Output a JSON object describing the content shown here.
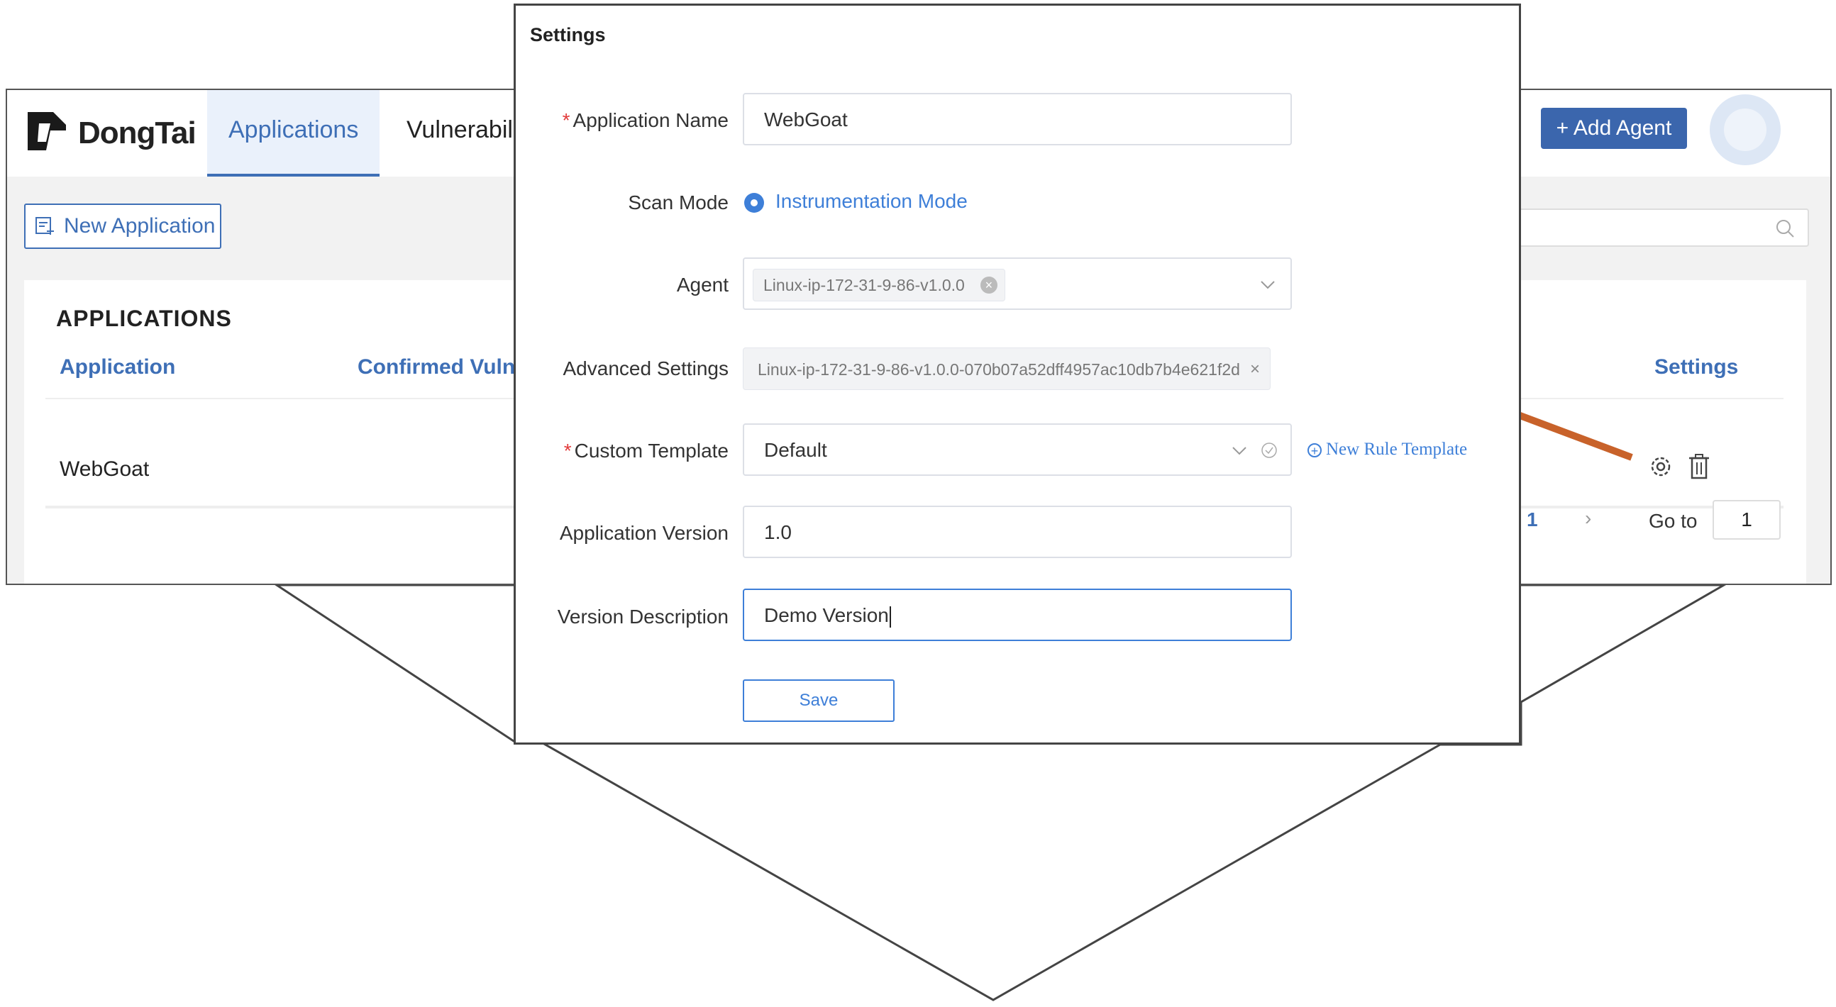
{
  "app": {
    "logo_text": "DongTai",
    "nav": {
      "active_tab": "Applications",
      "other_tab": "Vulnerabiliti"
    },
    "add_agent_label": "+ Add Agent",
    "new_application_label": "New Application",
    "panel_title": "APPLICATIONS",
    "table": {
      "headers": {
        "application": "Application",
        "confirmed": "Confirmed Vulne",
        "settings": "Settings"
      },
      "rows": [
        {
          "application": "WebGoat"
        }
      ]
    },
    "pagination": {
      "current_page": "1",
      "next": "›",
      "goto_label": "Go to",
      "goto_value": "1"
    },
    "colors": {
      "primary": "#3b66ad",
      "link": "#3e7fd8",
      "arrow": "#c8622a"
    }
  },
  "dialog": {
    "title": "Settings",
    "fields": {
      "application_name": {
        "label": "Application Name",
        "value": "WebGoat"
      },
      "scan_mode": {
        "label": "Scan Mode",
        "value": "Instrumentation Mode"
      },
      "agent": {
        "label": "Agent",
        "tag": "Linux-ip-172-31-9-86-v1.0.0"
      },
      "advanced_settings": {
        "label": "Advanced Settings",
        "tag": "Linux-ip-172-31-9-86-v1.0.0-070b07a52dff4957ac10db7b4e621f2d"
      },
      "custom_template": {
        "label": "Custom Template",
        "value": "Default",
        "link": "New Rule Template"
      },
      "application_version": {
        "label": "Application Version",
        "value": "1.0"
      },
      "version_description": {
        "label": "Version Description",
        "value": "Demo Version"
      }
    },
    "save_label": "Save"
  }
}
